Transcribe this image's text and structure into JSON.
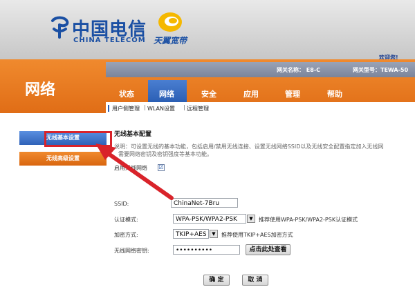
{
  "branding": {
    "telecom_cn": "中国电信",
    "telecom_en": "CHINA TELECOM",
    "tianyi": "天翼宽带"
  },
  "header": {
    "welcome": "欢迎您!",
    "gateway_name": "网关名称： E8-C",
    "gateway_model": "网关型号：TEWA-50"
  },
  "section_title": "网络",
  "tabs": [
    {
      "label": "状态"
    },
    {
      "label": "网络"
    },
    {
      "label": "安全"
    },
    {
      "label": "应用"
    },
    {
      "label": "管理"
    },
    {
      "label": "帮助"
    }
  ],
  "subnav": {
    "items": [
      "用户侧管理",
      "WLAN设置",
      "远程管理"
    ],
    "separator": "|"
  },
  "sidebar": {
    "items": [
      {
        "label": "无线基本设置",
        "active": true
      },
      {
        "label": "无线高级设置",
        "active": false
      }
    ]
  },
  "content": {
    "title": "无线基本配置",
    "description_line1": "说明：可设置无线的基本功能，包括启用/禁用无线连接、设置无线网络SSID以及无线安全配置指定加入无线网",
    "description_line2": "需要网络密钥及密钥强度等基本功能。",
    "enable_label": "启用无线网络",
    "enable_checked": true,
    "checkmark": "☑",
    "ssid_label": "SSID:",
    "ssid_value": "ChinaNet-7Bru",
    "auth_label": "认证模式:",
    "auth_value": "WPA-PSK/WPA2-PSK",
    "auth_hint": "推荐使用WPA-PSK/WPA2-PSK认证模式",
    "encrypt_label": "加密方式:",
    "encrypt_value": "TKIP+AES",
    "encrypt_hint": "推荐使用TKIP+AES加密方式",
    "key_label": "无线网络密钥:",
    "key_value": "••••••••••",
    "show_key_button": "点击此处查看",
    "confirm_button": "确 定",
    "cancel_button": "取 消",
    "dropdown_arrow": "▼"
  },
  "colors": {
    "orange": "#e8761f",
    "blue": "#2b5fb4",
    "annotation_red": "#d9232a"
  }
}
